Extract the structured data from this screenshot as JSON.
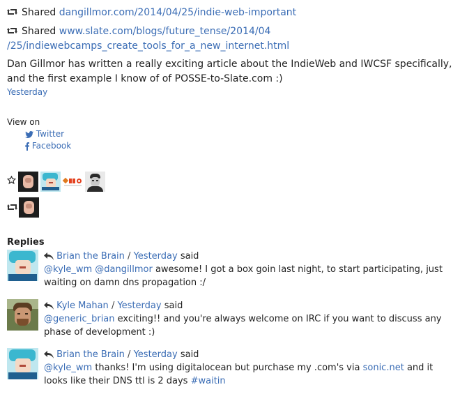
{
  "shared1": {
    "label": "Shared",
    "link": "dangillmor.com/2014/04/25/indie-web-important"
  },
  "shared2": {
    "label": "Shared",
    "link_line1": "www.slate.com/blogs/future_tense/2014/04",
    "link_line2": "/25/indiewebcamps_create_tools_for_a_new_internet.html"
  },
  "post": {
    "text": "Dan Gillmor has written a really exciting article about the IndieWeb and IWCSF specifically, and the first example I know of of POSSE-to-Slate.com :)",
    "time": "Yesterday"
  },
  "view_on": {
    "label": "View on",
    "twitter": "Twitter",
    "facebook": "Facebook"
  },
  "replies": {
    "title": "Replies",
    "items": [
      {
        "author": "Brian the Brain",
        "time": "Yesterday",
        "said": "said",
        "mentions": "@kyle_wm @dangillmor",
        "text": "awesome! I got a box goin last night, to start participating, just waiting on damn dns propagation :/"
      },
      {
        "author": "Kyle Mahan",
        "time": "Yesterday",
        "said": "said",
        "mentions": "@generic_brian",
        "text": "exciting!! and you're always welcome on IRC if you want to discuss any phase of development :)"
      },
      {
        "author": "Brian the Brain",
        "time": "Yesterday",
        "said": "said",
        "mentions": "@kyle_wm",
        "text_before": "thanks! I'm using digitalocean but purchase my .com's via",
        "link": "sonic.net",
        "text_after": "and it looks like their DNS ttl is 2 days",
        "hashtag": "#waitin"
      }
    ]
  },
  "colors": {
    "link": "#3b6db5",
    "text": "#222222"
  }
}
